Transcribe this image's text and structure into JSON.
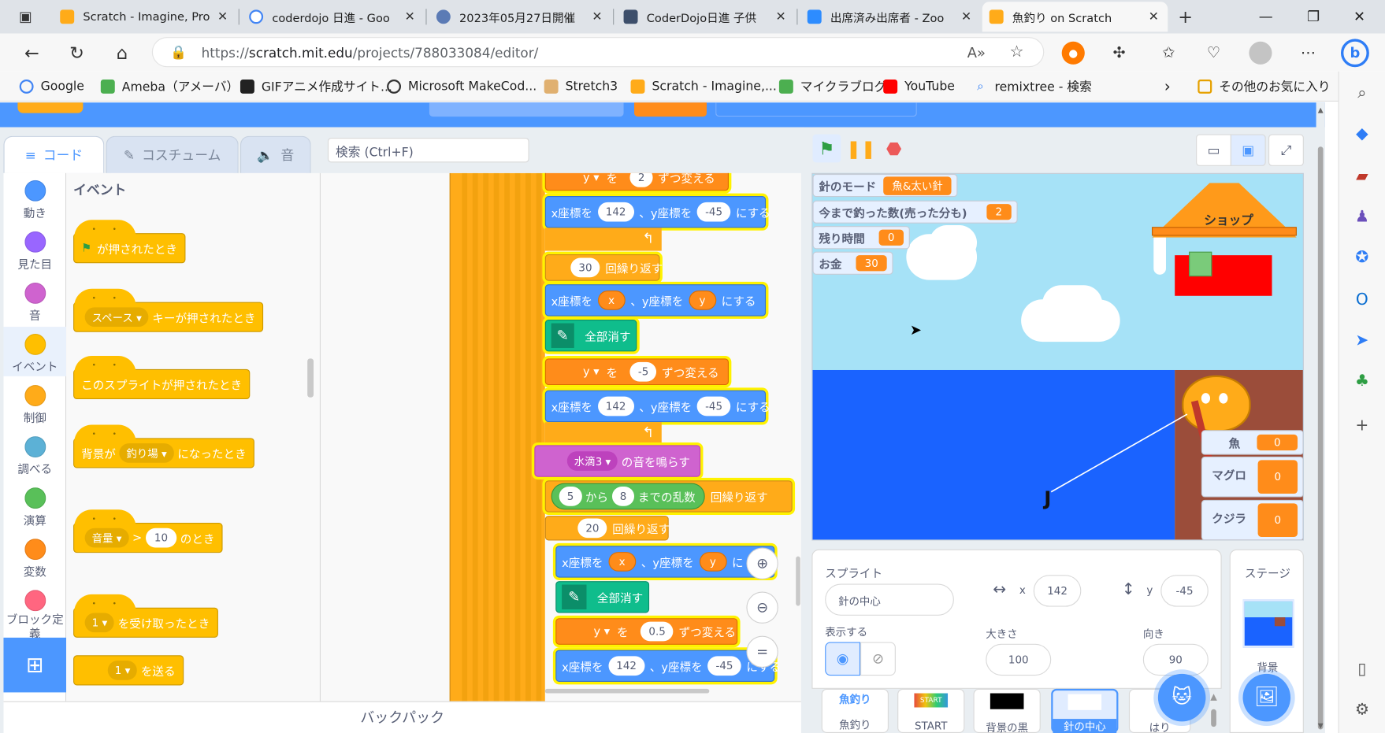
{
  "browser": {
    "tabs": [
      {
        "title": "Scratch - Imagine, Pro",
        "icon": "scratch-icon"
      },
      {
        "title": "coderdojo 日進 - Goo",
        "icon": "google-icon"
      },
      {
        "title": "2023年05月27日開催",
        "icon": "document-icon"
      },
      {
        "title": "CoderDojo日進 子供",
        "icon": "coderdojo-icon"
      },
      {
        "title": "出席済み出席者 - Zoo",
        "icon": "zoom-icon"
      },
      {
        "title": "魚釣り on Scratch",
        "icon": "scratch-icon"
      }
    ],
    "url_prefix": "https://",
    "url_host": "scratch.mit.edu",
    "url_path": "/projects/788033084/editor/",
    "bookmarks": [
      "Google",
      "Ameba（アメーバ）",
      "GIFアニメ作成サイト...",
      "Microsoft MakeCod...",
      "Stretch3",
      "Scratch - Imagine,...",
      "マイクラブログ",
      "YouTube",
      "remixtree - 検索"
    ],
    "other_favorites": "その他のお気に入り"
  },
  "scratch": {
    "tabs": {
      "code": "コード",
      "costume": "コスチューム",
      "sound": "音"
    },
    "search_placeholder": "検索 (Ctrl+F)",
    "categories": [
      {
        "label": "動き",
        "color": "#4c97ff"
      },
      {
        "label": "見た目",
        "color": "#9966ff"
      },
      {
        "label": "音",
        "color": "#cf63cf"
      },
      {
        "label": "イベント",
        "color": "#ffbf00"
      },
      {
        "label": "制御",
        "color": "#ffab19"
      },
      {
        "label": "調べる",
        "color": "#5cb1d6"
      },
      {
        "label": "演算",
        "color": "#59c059"
      },
      {
        "label": "変数",
        "color": "#ff8c1a"
      },
      {
        "label": "ブロック定義",
        "color": "#ff6680"
      }
    ],
    "palette": {
      "header": "イベント",
      "flag_clicked": "が押されたとき",
      "key_dropdown": "スペース ▾",
      "key_pressed": "キーが押されたとき",
      "sprite_clicked": "このスプライトが押されたとき",
      "backdrop_prefix": "背景が",
      "backdrop_dropdown": "釣り場 ▾",
      "backdrop_suffix": "になったとき",
      "loudness_dropdown": "音量 ▾",
      "loudness_gt": ">",
      "loudness_value": "10",
      "loudness_suffix": "のとき",
      "receive_dropdown": "1 ▾",
      "receive_suffix": "を受け取ったとき",
      "broadcast_dropdown": "1 ▾",
      "broadcast_suffix": "を送る"
    },
    "backpack": "バックパック",
    "script": {
      "change_y_1": {
        "var": "y ▾",
        "to": "を",
        "val": "2",
        "suffix": "ずつ変える"
      },
      "goto_1": {
        "xlabel": "x座標を",
        "x": "142",
        "ylabel": "、y座標を",
        "y": "-45",
        "suffix": "にする"
      },
      "repeat_1": {
        "count": "30",
        "label": "回繰り返す"
      },
      "goto_2": {
        "xlabel": "x座標を",
        "x": "x",
        "ylabel": "、y座標を",
        "y": "y",
        "suffix": "にする"
      },
      "clear_1": "全部消す",
      "change_y_2": {
        "var": "y ▾",
        "to": "を",
        "val": "-5",
        "suffix": "ずつ変える"
      },
      "goto_3": {
        "xlabel": "x座標を",
        "x": "142",
        "ylabel": "、y座標を",
        "y": "-45",
        "suffix": "にする"
      },
      "sound": {
        "dropdown": "水滴3 ▾",
        "suffix": "の音を鳴らす"
      },
      "repeat_rand": {
        "from": "5",
        "mid": "から",
        "to": "8",
        "label": "までの乱数",
        "suffix": "回繰り返す"
      },
      "repeat_2": {
        "count": "20",
        "label": "回繰り返す"
      },
      "goto_4": {
        "xlabel": "x座標を",
        "x": "x",
        "ylabel": "、y座標を",
        "y": "y",
        "suffix": "に"
      },
      "clear_2": "全部消す",
      "change_y_3": {
        "var": "y ▾",
        "to": "を",
        "val": "0.5",
        "suffix": "ずつ変える"
      },
      "goto_5": {
        "xlabel": "x座標を",
        "x": "142",
        "ylabel": "、y座標を",
        "y": "-45",
        "suffix": "にする"
      }
    },
    "monitors": [
      {
        "label": "針のモード",
        "value": "魚&太い針"
      },
      {
        "label": "今まで釣った数(売った分も)",
        "value": "2"
      },
      {
        "label": "残り時間",
        "value": "0"
      },
      {
        "label": "お金",
        "value": "30"
      }
    ],
    "shop_label": "ショップ",
    "catch_monitors": [
      {
        "label": "魚",
        "value": "0"
      },
      {
        "label": "マグロ",
        "value": "0"
      },
      {
        "label": "クジラ",
        "value": "0"
      }
    ],
    "sprite_info": {
      "sprite_label": "スプライト",
      "sprite_name": "針の中心",
      "x_label": "x",
      "x_value": "142",
      "y_label": "y",
      "y_value": "-45",
      "show_label": "表示する",
      "size_label": "大きさ",
      "size_value": "100",
      "direction_label": "向き",
      "direction_value": "90"
    },
    "stage_pane": {
      "label": "ステージ",
      "backdrop_label": "背景"
    },
    "sprites": [
      {
        "name": "魚釣り",
        "thumb": "魚釣り"
      },
      {
        "name": "START",
        "thumb": "START"
      },
      {
        "name": "背景の黒",
        "thumb": ""
      },
      {
        "name": "針の中心",
        "thumb": ""
      },
      {
        "name": "はり",
        "thumb": ""
      }
    ]
  }
}
